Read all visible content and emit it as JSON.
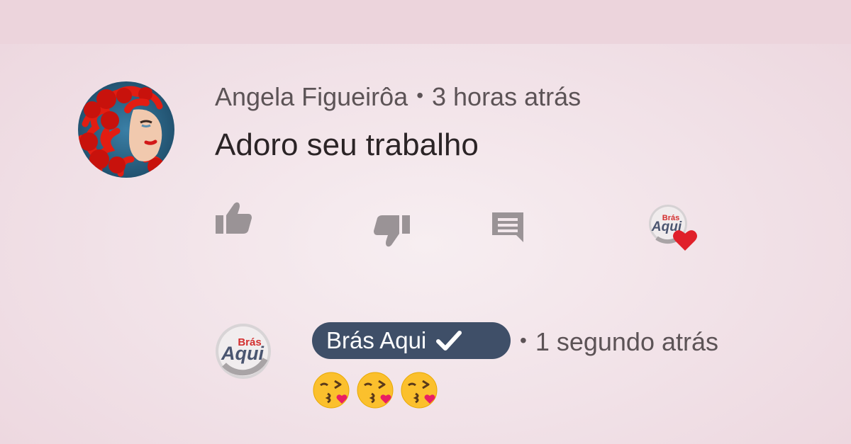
{
  "comment": {
    "author": "Angela Figueirôa",
    "separator": "•",
    "time": "3 horas atrás",
    "text": "Adoro seu trabalho",
    "avatar_icon": "user-avatar-red-hair",
    "actions": {
      "like_icon": "thumbs-up-icon",
      "dislike_icon": "thumbs-down-icon",
      "reply_icon": "reply-comment-icon",
      "hearted_icon": "creator-heart-icon"
    }
  },
  "reply": {
    "channel_name": "Brás Aqui",
    "verified_icon": "checkmark-icon",
    "separator": "•",
    "time": "1 segundo atrás",
    "emojis": [
      "😘",
      "😘",
      "😘"
    ],
    "logo": {
      "line1": "Brás",
      "line2": "Aqui"
    }
  },
  "colors": {
    "pill": "#3f4f68",
    "heart": "#e0202a",
    "text": "#2b2426",
    "meta_text": "#5c5356",
    "icon_gray": "#9a9396"
  }
}
